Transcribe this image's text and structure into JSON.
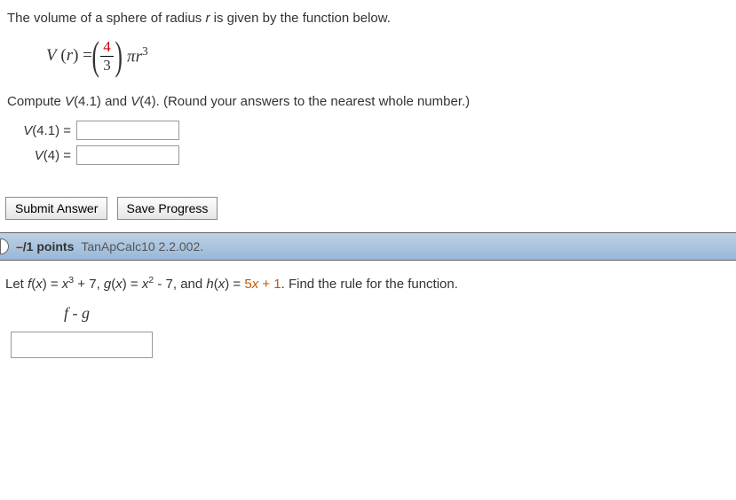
{
  "problem1": {
    "intro_a": "The volume of a sphere of radius ",
    "intro_var": "r",
    "intro_b": " is given by the function below.",
    "formula_lhs_v": "V",
    "formula_lhs_r": "r",
    "formula_eq1": "(",
    "formula_eq0": ") = ",
    "frac_num": "4",
    "frac_den": "3",
    "formula_pi": "π",
    "formula_r": "r",
    "formula_exp": "3",
    "compute_a": "Compute ",
    "compute_v1func": "V",
    "compute_v1arg": "(4.1) and ",
    "compute_v2func": "V",
    "compute_v2arg": "(4). (Round your answers to the nearest whole number.)",
    "label1_f": "V",
    "label1_arg": "(4.1) =",
    "label2_f": "V",
    "label2_arg": "(4) =",
    "value1": "",
    "value2": ""
  },
  "buttons": {
    "submit": "Submit Answer",
    "save": "Save Progress"
  },
  "header": {
    "points_neg": "–",
    "points_rest": "/1 points",
    "ref": "TanApCalc10 2.2.002."
  },
  "problem2": {
    "let": "Let ",
    "f_lhs": "f",
    "f_of": "(",
    "f_var": "x",
    "f_cl": ") = ",
    "f_x": "x",
    "f_exp": "3",
    "f_rest": " + 7, ",
    "g_lhs": "g",
    "g_of": "(",
    "g_var": "x",
    "g_cl": ") = ",
    "g_x": "x",
    "g_exp": "2",
    "g_rest": " - 7, and ",
    "h_lhs": "h",
    "h_of": "(",
    "h_var": "x",
    "h_cl": ") = ",
    "h_5": "5",
    "h_x": "x",
    "h_plus1": " + 1",
    "tail": ". Find the rule for the function.",
    "rule_f": "f",
    "rule_minus": " - ",
    "rule_g": "g",
    "answer": ""
  }
}
